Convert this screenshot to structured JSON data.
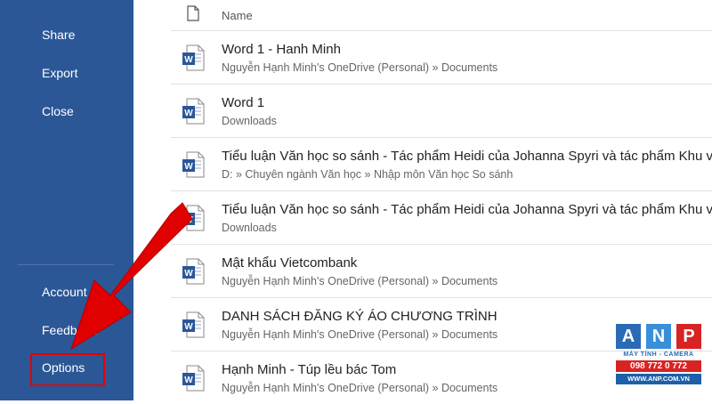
{
  "sidebar": {
    "items": [
      {
        "label": "Share"
      },
      {
        "label": "Export"
      },
      {
        "label": "Close"
      },
      {
        "label": "Account"
      },
      {
        "label": "Feedback"
      },
      {
        "label": "Options"
      }
    ]
  },
  "file_list": {
    "header": {
      "name_label": "Name"
    },
    "files": [
      {
        "name": "Word 1 - Hanh Minh",
        "path": "Nguyễn Hạnh Minh's OneDrive (Personal) » Documents"
      },
      {
        "name": "Word 1",
        "path": "Downloads"
      },
      {
        "name": "Tiểu luận Văn học so sánh - Tác phẩm Heidi của Johanna Spyri và tác phẩm Khu vườn",
        "path": "D: » Chuyên ngành Văn học » Nhập môn Văn học So sánh"
      },
      {
        "name": "Tiểu luận Văn học so sánh - Tác phẩm Heidi của Johanna Spyri và tác phẩm Khu vườn",
        "path": "Downloads"
      },
      {
        "name": "Mật khẩu Vietcombank",
        "path": "Nguyễn Hạnh Minh's OneDrive (Personal) » Documents"
      },
      {
        "name": "DANH SÁCH ĐĂNG KÝ ÁO CHƯƠNG TRÌNH",
        "path": "Nguyễn Hạnh Minh's OneDrive (Personal) » Documents"
      },
      {
        "name": "Hạnh Minh - Túp lều bác Tom",
        "path": "Nguyễn Hạnh Minh's OneDrive (Personal) » Documents"
      }
    ]
  },
  "watermark": {
    "letters": [
      "A",
      "N",
      "P"
    ],
    "tagline": "MÁY TÍNH - CAMERA",
    "phone": "098 772 0 772",
    "website": "WWW.ANP.COM.VN"
  },
  "colors": {
    "sidebar_bg": "#2b5797",
    "highlight_red": "#e30000",
    "word_blue": "#2b5797"
  },
  "icons": {
    "file_header": "document-icon",
    "file_row": "word-document-icon",
    "annotation": "red-arrow-icon"
  }
}
